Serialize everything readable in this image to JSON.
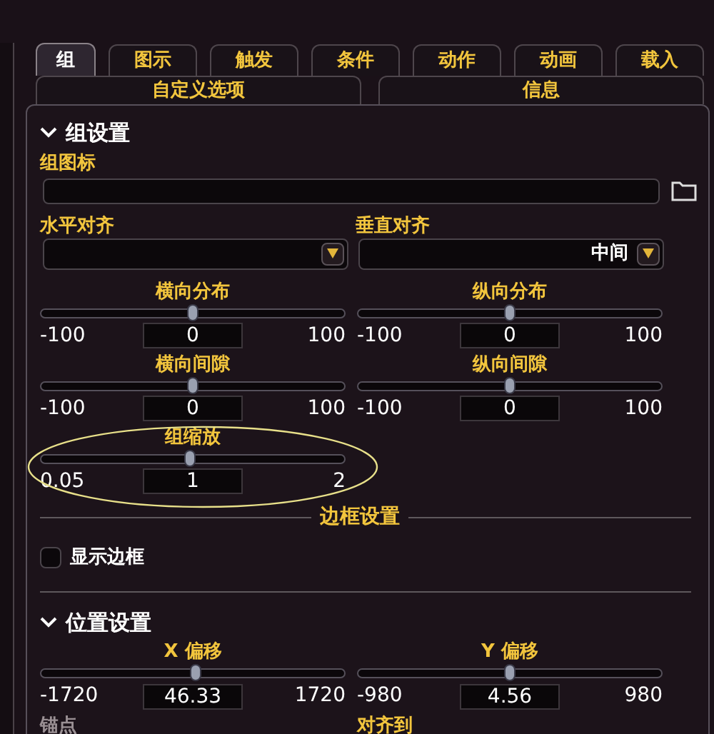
{
  "tabs": [
    {
      "label": "组",
      "selected": true
    },
    {
      "label": "图示",
      "selected": false
    },
    {
      "label": "触发",
      "selected": false
    },
    {
      "label": "条件",
      "selected": false
    },
    {
      "label": "动作",
      "selected": false
    },
    {
      "label": "动画",
      "selected": false
    },
    {
      "label": "载入",
      "selected": false
    }
  ],
  "subtabs": [
    {
      "label": "自定义选项",
      "selected": false
    },
    {
      "label": "信息",
      "selected": false
    }
  ],
  "group_settings": {
    "title": "组设置",
    "expanded": true,
    "icon_label": "组图标",
    "dropdowns": [
      {
        "label": "水平对齐"
      },
      {
        "label": "垂直对齐",
        "value": "中间"
      }
    ],
    "sliders": [
      {
        "label": "横向分布",
        "min": "-100",
        "max": "100",
        "value": "0",
        "level": 0.5
      },
      {
        "label": "纵向分布",
        "min": "-100",
        "max": "100",
        "value": "0",
        "level": 0.5
      },
      {
        "label": "横向间隙",
        "min": "-100",
        "max": "100",
        "value": "0",
        "level": 0.5
      },
      {
        "label": "纵向间隙",
        "min": "-100",
        "max": "100",
        "value": "0",
        "level": 0.5
      },
      {
        "label": "组缩放",
        "min": "0.05",
        "max": "2",
        "value": "1",
        "level": 0.49
      }
    ],
    "border_heading": "边框设置",
    "show_border": {
      "label": "显示边框",
      "checked": false
    }
  },
  "position_settings": {
    "title": "位置设置",
    "expanded": true,
    "sliders": [
      {
        "label": "X 偏移",
        "min": "-1720",
        "max": "1720",
        "value": "46.33",
        "level": 0.51
      },
      {
        "label": "Y 偏移",
        "min": "-980",
        "max": "980",
        "value": "4.56",
        "level": 0.5
      }
    ],
    "anchor_label": "锚点",
    "align_to_label": "对齐到"
  }
}
